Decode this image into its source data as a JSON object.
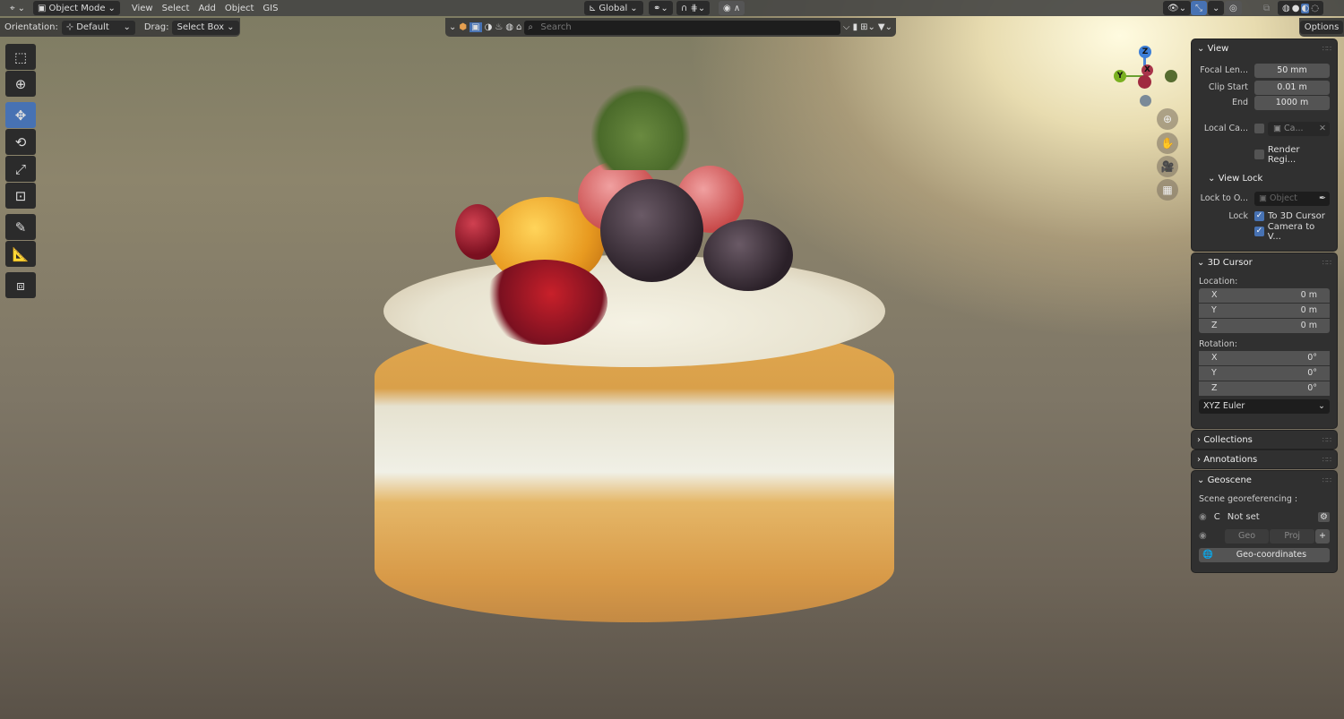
{
  "header": {
    "editor_icon": "editor-type-icon",
    "mode": "Object Mode",
    "menus": [
      "View",
      "Select",
      "Add",
      "Object",
      "GIS"
    ],
    "transform_orientation": "Global"
  },
  "tool_header": {
    "orientation_label": "Orientation:",
    "orientation_value": "Default",
    "drag_label": "Drag:",
    "drag_value": "Select Box"
  },
  "outliner_filter": {
    "search_placeholder": "Search"
  },
  "options_label": "Options",
  "toolbar": [
    "select-box-icon",
    "cursor-icon",
    "move-icon",
    "rotate-icon",
    "scale-icon",
    "transform-icon",
    "annotate-icon",
    "measure-icon",
    "add-cube-icon"
  ],
  "gizmo": {
    "z": "Z",
    "y": "Y",
    "x": "X"
  },
  "view_panel": {
    "title": "View",
    "focal_label": "Focal Len...",
    "focal": "50 mm",
    "clip_start_label": "Clip Start",
    "clip_start": "0.01 m",
    "end_label": "End",
    "end": "1000 m",
    "local_camera_label": "Local Ca...",
    "local_camera_value": "Ca...",
    "render_region": "Render Regi...",
    "view_lock_title": "View Lock",
    "lock_object_label": "Lock to O...",
    "lock_object_placeholder": "Object",
    "lock_label": "Lock",
    "to_3d_cursor": "To 3D Cursor",
    "camera_to_view": "Camera to V..."
  },
  "cursor_panel": {
    "title": "3D Cursor",
    "location_label": "Location:",
    "location": [
      {
        "axis": "X",
        "value": "0 m"
      },
      {
        "axis": "Y",
        "value": "0 m"
      },
      {
        "axis": "Z",
        "value": "0 m"
      }
    ],
    "rotation_label": "Rotation:",
    "rotation": [
      {
        "axis": "X",
        "value": "0°"
      },
      {
        "axis": "Y",
        "value": "0°"
      },
      {
        "axis": "Z",
        "value": "0°"
      }
    ],
    "rotation_mode": "XYZ Euler"
  },
  "collections_title": "Collections",
  "annotations_title": "Annotations",
  "geoscene": {
    "title": "Geoscene",
    "georef_label": "Scene georeferencing :",
    "crs_letter": "C",
    "crs_value": "Not set",
    "geo": "Geo",
    "proj": "Proj",
    "geo_coordinates": "Geo-coordinates"
  },
  "colors": {
    "accent": "#4772b3",
    "panel": "#303030",
    "field": "#545454"
  }
}
